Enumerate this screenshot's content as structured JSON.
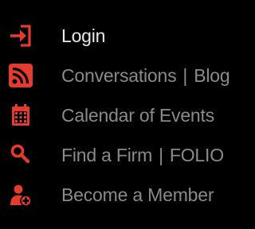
{
  "colors": {
    "background": "#000000",
    "icon": "#e53a2e",
    "text": "#8a8a8a",
    "active_text": "#e8e8e8"
  },
  "menu": {
    "items": [
      {
        "icon": "login-icon",
        "label": "Login"
      },
      {
        "icon": "rss-icon",
        "label": "Conversations",
        "separator": "|",
        "label2": "Blog"
      },
      {
        "icon": "calendar-icon",
        "label": "Calendar of Events"
      },
      {
        "icon": "search-icon",
        "label": "Find a Firm",
        "separator": "|",
        "label2": "FOLIO"
      },
      {
        "icon": "add-user-icon",
        "label": "Become a Member"
      }
    ]
  }
}
